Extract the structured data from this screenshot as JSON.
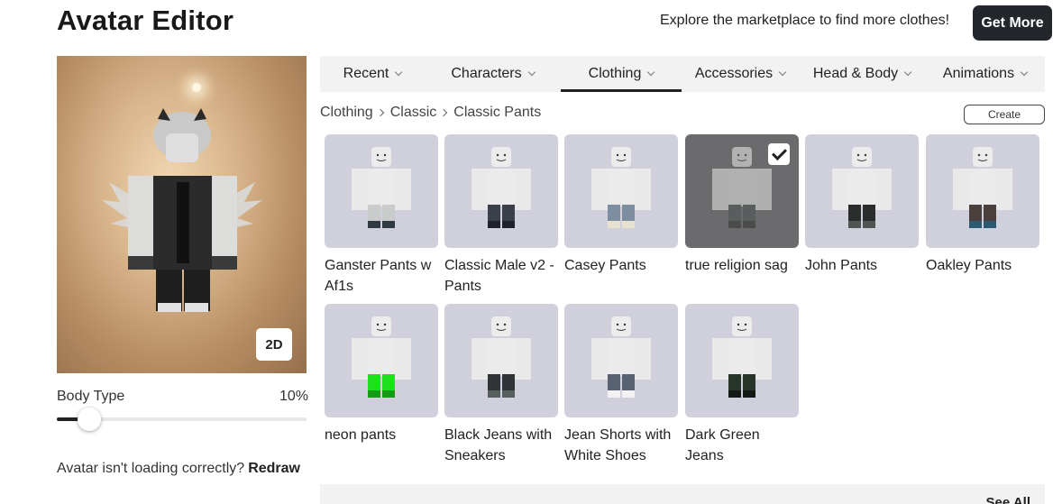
{
  "header": {
    "title": "Avatar Editor",
    "promo_text": "Explore the marketplace to find more clothes!",
    "get_more_label": "Get More"
  },
  "avatar": {
    "toggle_2d_label": "2D",
    "body_type_label": "Body Type",
    "body_type_value": "10%",
    "body_type_fraction": 0.1,
    "loading_text": "Avatar isn't loading correctly?",
    "redraw_label": "Redraw"
  },
  "tabs": [
    {
      "label": "Recent",
      "active": false
    },
    {
      "label": "Characters",
      "active": false
    },
    {
      "label": "Clothing",
      "active": true
    },
    {
      "label": "Accessories",
      "active": false
    },
    {
      "label": "Head & Body",
      "active": false
    },
    {
      "label": "Animations",
      "active": false
    }
  ],
  "breadcrumb": [
    "Clothing",
    "Classic",
    "Classic Pants"
  ],
  "create_label": "Create",
  "items": [
    {
      "name": "Ganster Pants w Af1s",
      "pants": "#c9cccb",
      "accent": "#2f3b40",
      "selected": false
    },
    {
      "name": "Classic Male v2 - Pants",
      "pants": "#3a3f4a",
      "accent": "#1e232b",
      "selected": false
    },
    {
      "name": "Casey Pants",
      "pants": "#7d8ea0",
      "accent": "#e8e1d2",
      "selected": false
    },
    {
      "name": "true religion sag",
      "pants": "#4d5250",
      "accent": "#2e3331",
      "selected": true
    },
    {
      "name": "John Pants",
      "pants": "#2a2d2b",
      "accent": "#4e5553",
      "selected": false
    },
    {
      "name": "Oakley Pants",
      "pants": "#4a3f3a",
      "accent": "#2b5a72",
      "selected": false
    },
    {
      "name": "neon pants",
      "pants": "#1ee01e",
      "accent": "#169a16",
      "selected": false
    },
    {
      "name": "Black Jeans with Sneakers",
      "pants": "#303437",
      "accent": "#56605c",
      "selected": false
    },
    {
      "name": "Jean Shorts with White Shoes",
      "pants": "#586272",
      "accent": "#f2f2f2",
      "selected": false
    },
    {
      "name": "Dark Green Jeans",
      "pants": "#263429",
      "accent": "#131a15",
      "selected": false
    }
  ],
  "see_all_label": "See All"
}
